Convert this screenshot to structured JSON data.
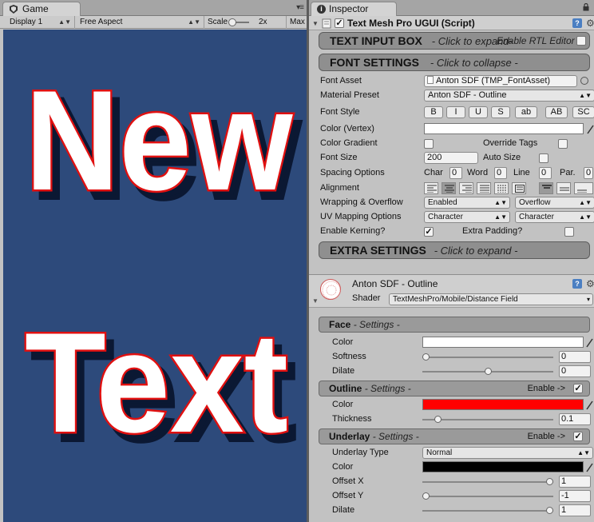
{
  "game": {
    "tab_label": "Game",
    "display": "Display 1",
    "aspect": "Free Aspect",
    "scale_label": "Scale",
    "scale_value": "2x",
    "max_label": "Max",
    "text_line1": "New",
    "text_line2": "Text",
    "colors": {
      "background": "#2d4a7b",
      "text_fill": "#ffffff",
      "outline": "#e01010",
      "shadow": "#0b1833"
    }
  },
  "inspector": {
    "tab_label": "Inspector",
    "component_title": "Text Mesh Pro UGUI (Script)",
    "text_input_section": {
      "title": "TEXT INPUT BOX",
      "hint": "- Click to expand-",
      "rtl_label": "Enable RTL Editor"
    },
    "font_section": {
      "title": "FONT SETTINGS",
      "hint": "- Click to collapse -"
    },
    "font_asset": {
      "label": "Font Asset",
      "value": "Anton SDF (TMP_FontAsset)"
    },
    "material_preset": {
      "label": "Material Preset",
      "value": "Anton SDF - Outline"
    },
    "font_style": {
      "label": "Font Style",
      "buttons": [
        "B",
        "I",
        "U",
        "S",
        "ab",
        "AB",
        "SC"
      ]
    },
    "color_vertex": {
      "label": "Color (Vertex)"
    },
    "color_gradient": {
      "label": "Color Gradient",
      "override_label": "Override Tags"
    },
    "font_size": {
      "label": "Font Size",
      "value": "200",
      "auto_label": "Auto Size"
    },
    "spacing": {
      "label": "Spacing Options",
      "char_label": "Char",
      "char_value": "0",
      "word_label": "Word",
      "word_value": "0",
      "line_label": "Line",
      "line_value": "0",
      "par_label": "Par.",
      "par_value": "0"
    },
    "alignment": {
      "label": "Alignment"
    },
    "wrapping": {
      "label": "Wrapping & Overflow",
      "wrap_value": "Enabled",
      "overflow_value": "Overflow"
    },
    "uv_mapping": {
      "label": "UV Mapping Options",
      "h_value": "Character",
      "v_value": "Character"
    },
    "kerning": {
      "label": "Enable Kerning?",
      "checked": true,
      "padding_label": "Extra Padding?",
      "padding_checked": false
    },
    "extra_section": {
      "title": "EXTRA SETTINGS",
      "hint": "- Click to expand -"
    },
    "material": {
      "name": "Anton SDF - Outline",
      "shader_label": "Shader",
      "shader_value": "TextMeshPro/Mobile/Distance Field"
    },
    "face": {
      "title": "Face",
      "subtitle": "- Settings -",
      "color_label": "Color",
      "color": "#ffffff",
      "softness_label": "Softness",
      "softness_value": "0",
      "dilate_label": "Dilate",
      "dilate_value": "0"
    },
    "outline": {
      "title": "Outline",
      "subtitle": "- Settings -",
      "enable_label": "Enable ->",
      "enabled": true,
      "color_label": "Color",
      "color": "#ff0000",
      "thickness_label": "Thickness",
      "thickness_value": "0.1"
    },
    "underlay": {
      "title": "Underlay",
      "subtitle": "- Settings -",
      "enable_label": "Enable ->",
      "enabled": true,
      "type_label": "Underlay Type",
      "type_value": "Normal",
      "color_label": "Color",
      "color": "#000000",
      "offset_x_label": "Offset X",
      "offset_x_value": "1",
      "offset_y_label": "Offset Y",
      "offset_y_value": "-1",
      "dilate_label": "Dilate",
      "dilate_value": "1"
    },
    "colors": {
      "help_icon": "#4b7fc2",
      "section_bar": "#8f8f8f"
    }
  }
}
